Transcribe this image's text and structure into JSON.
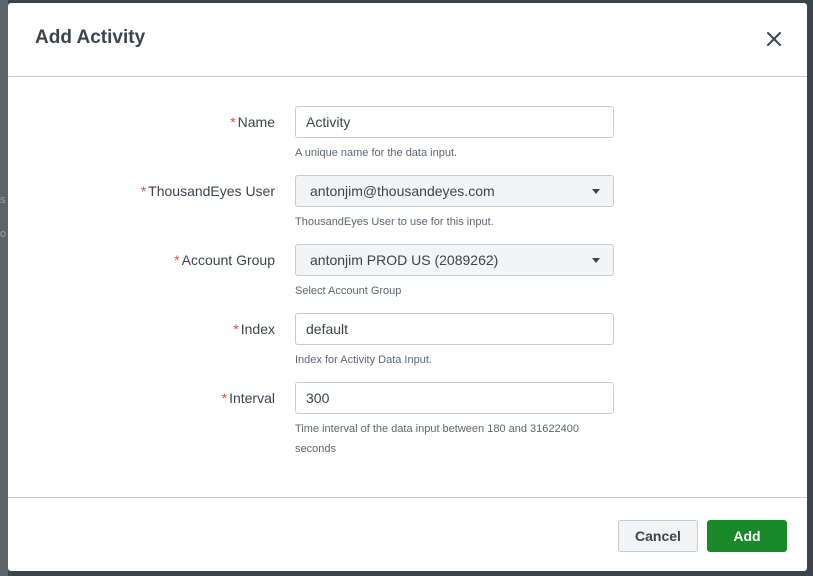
{
  "dialog": {
    "title": "Add Activity",
    "close_icon": "close-icon"
  },
  "fields": {
    "name": {
      "label": "Name",
      "value": "Activity",
      "help": "A unique name for the data input."
    },
    "user": {
      "label": "ThousandEyes User",
      "value": "antonjim@thousandeyes.com",
      "help": "ThousandEyes User to use for this input."
    },
    "account_group": {
      "label": "Account Group",
      "value": "antonjim PROD US (2089262)",
      "help": "Select Account Group"
    },
    "index": {
      "label": "Index",
      "value": "default",
      "help": "Index for Activity Data Input."
    },
    "interval": {
      "label": "Interval",
      "value": "300",
      "help": "Time interval of the data input between 180 and 31622400 seconds"
    }
  },
  "required_marker": "*",
  "footer": {
    "cancel_label": "Cancel",
    "add_label": "Add"
  },
  "colors": {
    "primary": "#1a8929",
    "required": "#dc4e41",
    "text": "#3c444d"
  }
}
